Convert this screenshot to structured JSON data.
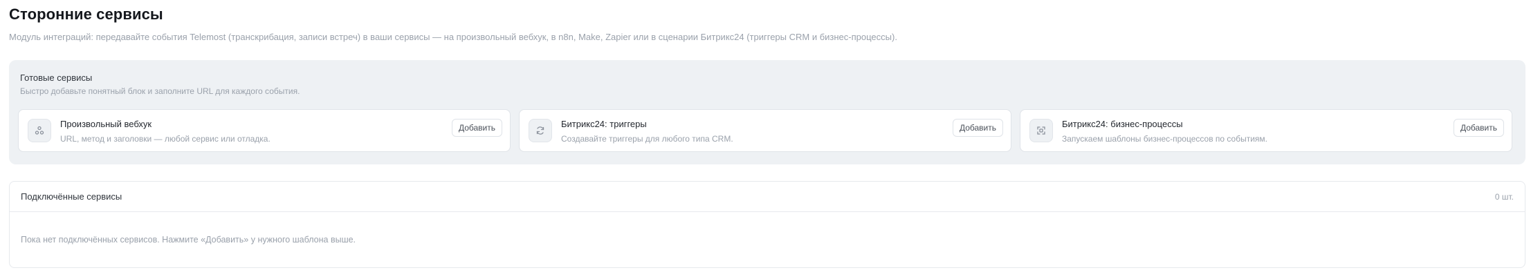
{
  "page": {
    "title": "Сторонние сервисы",
    "description": "Модуль интеграций: передавайте события Telemost (транскрибация, записи встреч) в ваши сервисы — на произвольный вебхук, в n8n, Make, Zapier или в сценарии Битрикс24 (триггеры CRM и бизнес-процессы)."
  },
  "ready_services": {
    "title": "Готовые сервисы",
    "subtitle": "Быстро добавьте понятный блок и заполните URL для каждого события.",
    "cards": [
      {
        "icon": "webhook-icon",
        "title": "Произвольный вебхук",
        "description": "URL, метод и заголовки — любой сервис или отладка.",
        "button": "Добавить"
      },
      {
        "icon": "refresh-icon",
        "title": "Битрикс24: триггеры",
        "description": "Создавайте триггеры для любого типа CRM.",
        "button": "Добавить"
      },
      {
        "icon": "process-icon",
        "title": "Битрикс24: бизнес-процессы",
        "description": "Запускаем шаблоны бизнес-процессов по событиям.",
        "button": "Добавить"
      }
    ]
  },
  "connected_services": {
    "title": "Подключённые сервисы",
    "count": "0 шт.",
    "empty_text": "Пока нет подключённых сервисов. Нажмите «Добавить» у нужного шаблона выше."
  },
  "colors": {
    "panel_bg": "#eef1f4",
    "border": "#dfe3e8",
    "muted_text": "#9aa1ab",
    "heading": "#15181d"
  }
}
